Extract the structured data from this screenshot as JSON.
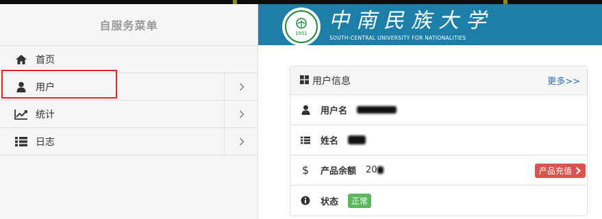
{
  "sidebar": {
    "title": "自服务菜单",
    "items": [
      {
        "label": "首页",
        "icon": "home-icon"
      },
      {
        "label": "用户",
        "icon": "user-icon"
      },
      {
        "label": "统计",
        "icon": "chart-line-icon"
      },
      {
        "label": "日志",
        "icon": "list-icon"
      }
    ]
  },
  "banner": {
    "name_cn": "中南民族大学",
    "name_en": "SOUTH-CENTRAL UNIVERSITY FOR NATIONALITIES",
    "logo_year": "1951",
    "background": "#1d7fa8"
  },
  "panel": {
    "title": "用户信息",
    "more_link": "更多>>",
    "rows": [
      {
        "label": "用户名",
        "value": ""
      },
      {
        "label": "姓名",
        "value": ""
      },
      {
        "label": "产品余额",
        "value": "20"
      },
      {
        "label": "状态",
        "value": "正常"
      }
    ],
    "charge_button": "产品充值"
  },
  "colors": {
    "highlight": "#d9252b",
    "link": "#2a6db5",
    "danger": "#d9534f",
    "success": "#5cb85c"
  }
}
